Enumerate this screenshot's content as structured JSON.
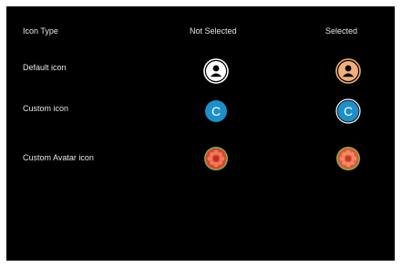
{
  "header": {
    "icon_type": "Icon Type",
    "not_selected": "Not Selected",
    "selected": "Selected"
  },
  "rows": [
    {
      "label": "Default icon",
      "icon": "person-icon"
    },
    {
      "label": "Custom icon",
      "icon": "letter-c-icon",
      "glyph": "C"
    },
    {
      "label": "Custom Avatar icon",
      "icon": "flower-avatar-icon"
    }
  ],
  "colors": {
    "background": "#000000",
    "text": "#e6e6e6",
    "default_not_selected": "#ffffff",
    "default_selected": "#f0b07a",
    "custom_blue": "#1d8fc9",
    "avatar_red": "#d8452e",
    "avatar_ring": "#7fae4a"
  }
}
